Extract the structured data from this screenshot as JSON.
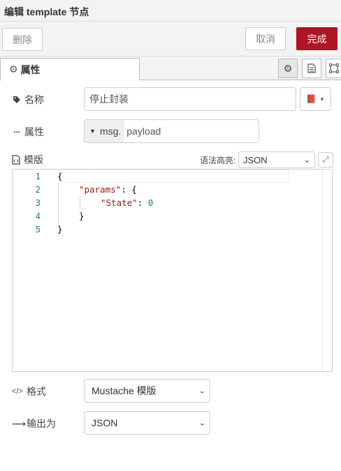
{
  "dialog": {
    "title": "编辑 template 节点"
  },
  "buttons": {
    "delete": "删除",
    "cancel": "取消",
    "done": "完成"
  },
  "tabs": {
    "properties": "属性"
  },
  "fields": {
    "name": {
      "label": "名称",
      "value": "停止封装"
    },
    "property": {
      "label": "属性",
      "type": "msg.",
      "value": "payload"
    },
    "template": {
      "label": "模版",
      "syntax_label": "语法高亮:",
      "syntax_value": "JSON"
    },
    "format": {
      "label": "格式",
      "value": "Mustache 模版"
    },
    "output": {
      "label": "输出为",
      "value": "JSON"
    }
  },
  "editor": {
    "line_numbers": [
      "1",
      "2",
      "3",
      "4",
      "5"
    ],
    "lines": [
      "{",
      "\"params\": {",
      "\"State\": 0",
      "}",
      "}"
    ]
  },
  "colors": {
    "accent": "#ad1625",
    "line_number": "#237893",
    "string": "#a31515",
    "number": "#098658"
  },
  "icons": {
    "properties_tab": "gear-icon",
    "name": "tag-icon",
    "property": "ellipsis-icon",
    "template": "file-code-icon",
    "format": "code-icon",
    "output": "arrow-right-icon",
    "name_library": "book-icon"
  }
}
